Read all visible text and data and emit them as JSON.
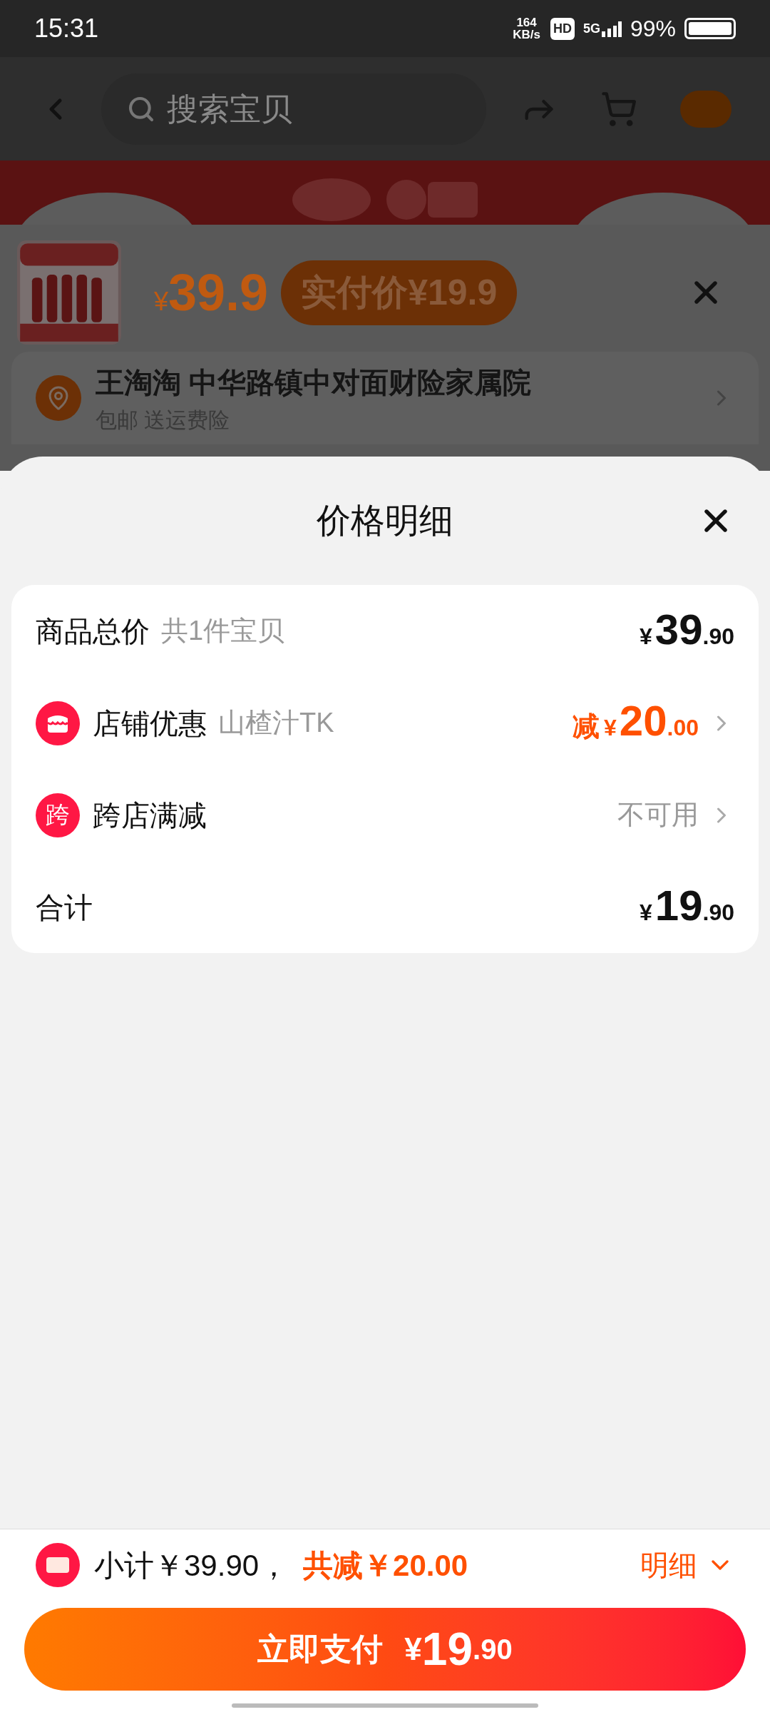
{
  "status_bar": {
    "time": "15:31",
    "net_speed": "164",
    "net_unit": "KB/s",
    "hd": "HD",
    "network": "5G",
    "battery": "99%"
  },
  "header": {
    "search_placeholder": "搜索宝贝"
  },
  "product": {
    "currency": "¥",
    "price": "39.9",
    "actual_price": "实付价¥19.9"
  },
  "address": {
    "name": "王淘淘",
    "detail": "中华路镇中对面财险家属院",
    "note": "包邮 送运费险"
  },
  "sheet": {
    "title": "价格明细",
    "rows": [
      {
        "kind": "amount",
        "label": "商品总价",
        "sublabel": "共1件宝贝",
        "currency": "¥",
        "amount": "39",
        "decimals": ".90",
        "arrow": false
      },
      {
        "kind": "discount",
        "label": "店铺优惠",
        "sublabel": "山楂汁TK",
        "prefix": "减",
        "currency": "¥",
        "amount": "20",
        "decimals": ".00",
        "arrow": true
      },
      {
        "kind": "status",
        "icon_text": "跨",
        "label": "跨店满减",
        "value": "不可用",
        "arrow": true
      },
      {
        "kind": "amount",
        "label": "合计",
        "currency": "¥",
        "amount": "19",
        "decimals": ".90",
        "arrow": false
      }
    ]
  },
  "footer": {
    "subtotal": "小计￥39.90，",
    "reduction": "共减￥20.00",
    "detail": "明细",
    "pay": {
      "label": "立即支付",
      "currency": "¥",
      "amount": "19",
      "decimals": ".90"
    }
  }
}
